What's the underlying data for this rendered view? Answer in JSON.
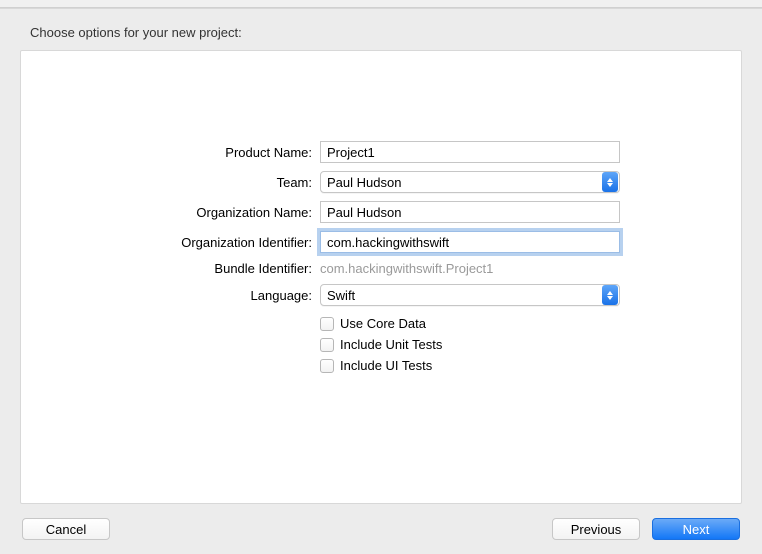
{
  "header": {
    "title": "Choose options for your new project:"
  },
  "form": {
    "productName": {
      "label": "Product Name:",
      "value": "Project1"
    },
    "team": {
      "label": "Team:",
      "value": "Paul Hudson"
    },
    "orgName": {
      "label": "Organization Name:",
      "value": "Paul Hudson"
    },
    "orgIdentifier": {
      "label": "Organization Identifier:",
      "value": "com.hackingwithswift"
    },
    "bundleIdentifier": {
      "label": "Bundle Identifier:",
      "value": "com.hackingwithswift.Project1"
    },
    "language": {
      "label": "Language:",
      "value": "Swift"
    },
    "checkboxes": {
      "useCoreData": "Use Core Data",
      "includeUnitTests": "Include Unit Tests",
      "includeUITests": "Include UI Tests"
    }
  },
  "buttons": {
    "cancel": "Cancel",
    "previous": "Previous",
    "next": "Next"
  }
}
